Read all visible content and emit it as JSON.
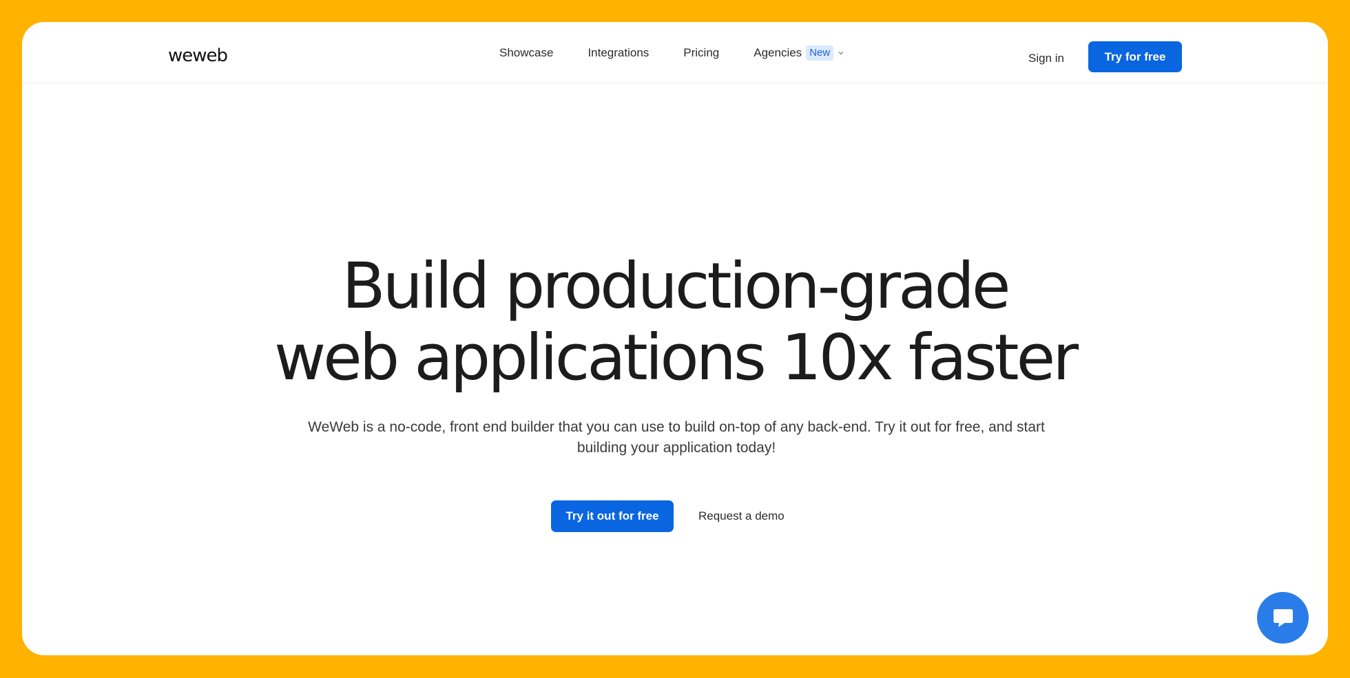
{
  "header": {
    "logo_text": "weweb",
    "nav": [
      {
        "label": "Showcase"
      },
      {
        "label": "Integrations"
      },
      {
        "label": "Pricing"
      },
      {
        "label": "Agencies",
        "badge": "New"
      }
    ],
    "sign_in_label": "Sign in",
    "cta_label": "Try for free"
  },
  "hero": {
    "title_line1": "Build production-grade",
    "title_line2": "web applications 10x faster",
    "subtitle_line1": "WeWeb is a no-code, front end builder that you can use to build on-top of any back-end. Try it out for free, and start",
    "subtitle_line2": "building your application today!",
    "primary_cta_label": "Try it out for free",
    "secondary_cta_label": "Request a demo"
  },
  "chat": {
    "icon": "chat-icon"
  },
  "colors": {
    "background": "#ffb300",
    "primary": "#0a66e0",
    "badge_bg": "#dbeaff",
    "badge_text": "#1e62d9",
    "chat": "#2a7de9"
  }
}
